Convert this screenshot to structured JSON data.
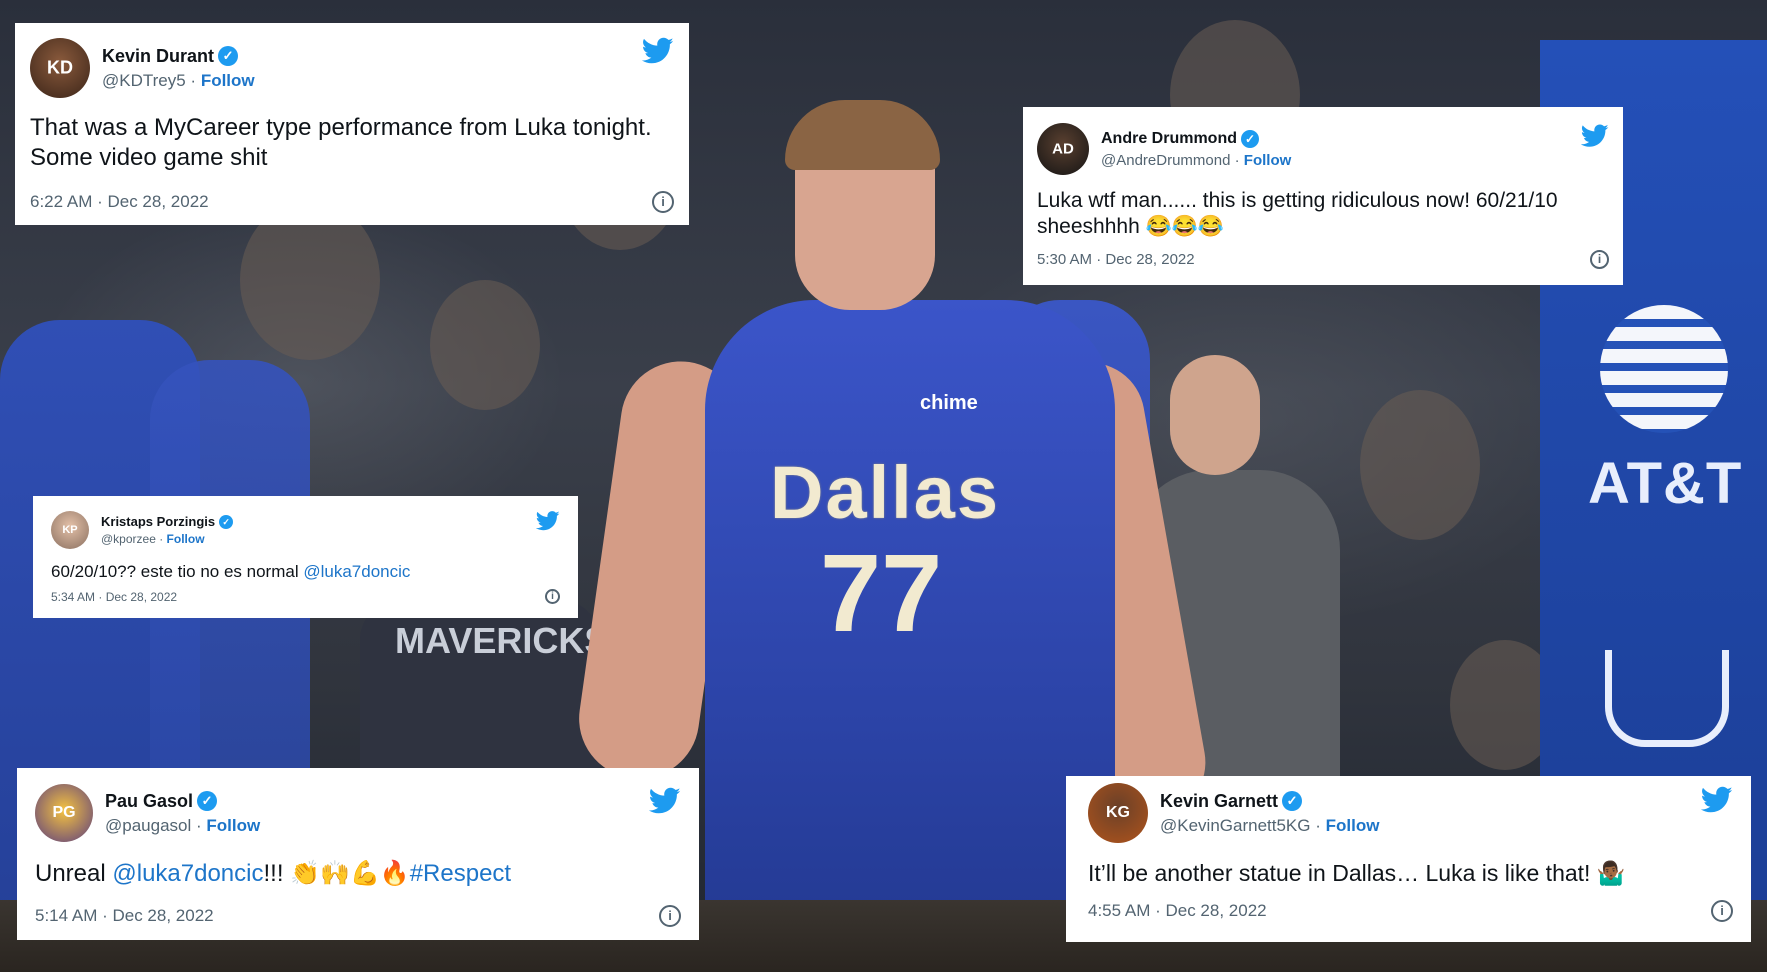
{
  "tweets": {
    "kd": {
      "name": "Kevin Durant",
      "handle": "@KDTrey5",
      "follow": "Follow",
      "text": "That was a MyCareer type performance from Luka tonight. Some video game shit",
      "time": "6:22 AM · Dec 28, 2022"
    },
    "drummond": {
      "name": "Andre Drummond",
      "handle": "@AndreDrummond",
      "follow": "Follow",
      "text": "Luka wtf man...... this is getting ridiculous now! 60/21/10 sheeshhhh 😂😂😂",
      "time": "5:30 AM · Dec 28, 2022"
    },
    "porzingis": {
      "name": "Kristaps Porzingis",
      "handle": "@kporzee",
      "follow": "Follow",
      "text_before": "60/20/10?? este tio no es normal ",
      "mention": "@luka7doncic",
      "time": "5:34 AM · Dec 28, 2022"
    },
    "gasol": {
      "name": "Pau Gasol",
      "handle": "@paugasol",
      "follow": "Follow",
      "text_before": "Unreal ",
      "mention": "@luka7doncic",
      "text_mid": "!!!  👏🙌💪🔥",
      "hashtag": "#Respect",
      "time": "5:14 AM · Dec 28, 2022"
    },
    "garnett": {
      "name": "Kevin Garnett",
      "handle": "@KevinGarnett5KG",
      "follow": "Follow",
      "text": "It’ll be another statue in Dallas… Luka is like that! 🤷🏾‍♂️",
      "time": "4:55 AM · Dec 28, 2022"
    }
  },
  "ui": {
    "separator": " · ",
    "bird_icon": "twitter-bird-icon",
    "verified_icon": "verified-badge-icon",
    "info_icon": "info-icon",
    "verified_glyph": "✓",
    "info_glyph": "i",
    "bird_glyph": "🐦"
  },
  "photo": {
    "jersey_text": "Dallas",
    "jersey_number": "77",
    "sponsor": "chime",
    "shirt_text": "MAVERICKS",
    "banner_text": "AT&T"
  },
  "colors": {
    "accent": "#1d9bf0",
    "link": "#1d75c9",
    "secondary_text": "#536471"
  }
}
